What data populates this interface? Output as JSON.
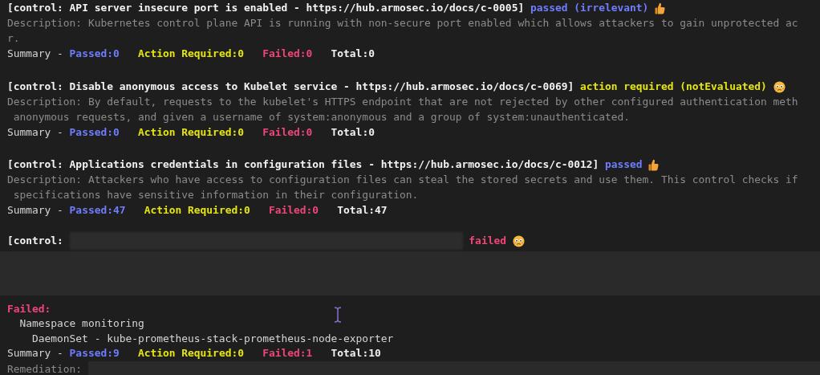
{
  "controls": [
    {
      "header": "[control: API server insecure port is enabled - https://hub.armosec.io/docs/c-0005]",
      "status": "passed (irrelevant)",
      "kind": "passed",
      "description": [
        "Description: Kubernetes control plane API is running with non-secure port enabled which allows attackers to gain unprotected ac",
        "r."
      ],
      "summary": [
        {
          "kind": "label",
          "text": "Summary -"
        },
        {
          "kind": "passed",
          "text": "Passed:0"
        },
        {
          "kind": "action",
          "text": "Action Required:0"
        },
        {
          "kind": "failed",
          "text": "Failed:0"
        },
        {
          "kind": "total",
          "text": "Total:0"
        }
      ]
    },
    {
      "header": "[control: Disable anonymous access to Kubelet service - https://hub.armosec.io/docs/c-0069]",
      "status": "action required (notEvaluated)",
      "kind": "action",
      "description": [
        "Description: By default, requests to the kubelet's HTTPS endpoint that are not rejected by other configured authentication meth",
        " anonymous requests, and given a username of system:anonymous and a group of system:unauthenticated."
      ],
      "summary": [
        {
          "kind": "label",
          "text": "Summary -"
        },
        {
          "kind": "passed",
          "text": "Passed:0"
        },
        {
          "kind": "action",
          "text": "Action Required:0"
        },
        {
          "kind": "failed",
          "text": "Failed:0"
        },
        {
          "kind": "total",
          "text": "Total:0"
        }
      ]
    },
    {
      "header": "[control: Applications credentials in configuration files - https://hub.armosec.io/docs/c-0012]",
      "status": "passed",
      "kind": "passed",
      "description": [
        "Description: Attackers who have access to configuration files can steal the stored secrets and use them. This control checks if",
        " specifications have sensitive information in their configuration."
      ],
      "summary": [
        {
          "kind": "label",
          "text": "Summary -"
        },
        {
          "kind": "passed",
          "text": "Passed:47"
        },
        {
          "kind": "action",
          "text": "Action Required:0"
        },
        {
          "kind": "failed",
          "text": "Failed:0"
        },
        {
          "kind": "total",
          "text": "Total:47"
        }
      ]
    },
    {
      "header": "[control:",
      "header_redacted": true,
      "status": "failed",
      "kind": "failed",
      "description_redacted": true,
      "failed_label": "Failed:",
      "failed_resources": [
        {
          "text": "Namespace monitoring",
          "children": [
            {
              "text": "DaemonSet - kube-prometheus-stack-prometheus-node-exporter"
            }
          ]
        }
      ],
      "summary": [
        {
          "kind": "label",
          "text": "Summary -"
        },
        {
          "kind": "passed",
          "text": "Passed:9"
        },
        {
          "kind": "action",
          "text": "Action Required:0"
        },
        {
          "kind": "failed",
          "text": "Failed:1"
        },
        {
          "kind": "total",
          "text": "Total:10"
        }
      ],
      "remediation_label": "Remediation:",
      "remediation_redacted": true
    }
  ]
}
